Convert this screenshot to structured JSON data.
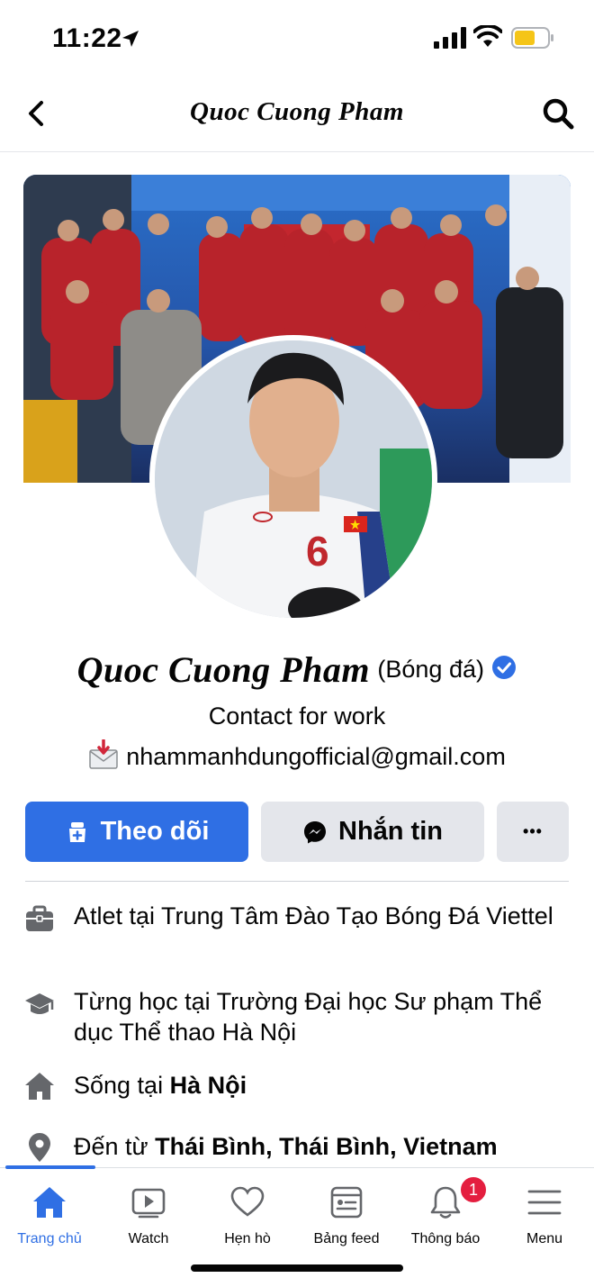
{
  "status": {
    "time": "11:22"
  },
  "nav": {
    "title": "Quoc Cuong Pham"
  },
  "profile": {
    "name": "Quoc Cuong Pham",
    "category": "(Bóng đá)",
    "bio_line1": "Contact for work",
    "bio_line2": "nhammanhdungofficial@gmail.com"
  },
  "actions": {
    "follow": "Theo dõi",
    "message": "Nhắn tin",
    "more": "•••"
  },
  "info": {
    "work_prefix": "Atlet tại Trung Tâm Đào Tạo Bóng Đá Viettel",
    "study": "Từng học tại Trường Đại học Sư phạm Thể dục Thể thao Hà Nội",
    "lives_prefix": "Sống tại ",
    "lives_place": "Hà Nội",
    "from_prefix": "Đến từ ",
    "from_place": "Thái Bình, Thái Bình, Vietnam"
  },
  "tabs": [
    {
      "label": "Trang chủ",
      "icon": "home-icon"
    },
    {
      "label": "Watch",
      "icon": "watch-icon"
    },
    {
      "label": "Hẹn hò",
      "icon": "heart-icon"
    },
    {
      "label": "Bảng feed",
      "icon": "feed-icon"
    },
    {
      "label": "Thông báo",
      "icon": "bell-icon",
      "badge": "1"
    },
    {
      "label": "Menu",
      "icon": "menu-icon"
    }
  ],
  "colors": {
    "accent": "#2f6fe4",
    "badge": "#e41e3f",
    "button_gray": "#e4e6eb"
  }
}
